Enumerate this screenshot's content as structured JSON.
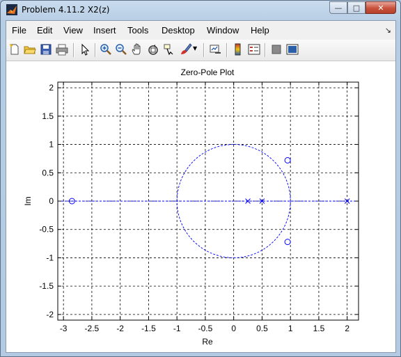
{
  "window": {
    "title": "Problem 4.11.2 X2(z)"
  },
  "menu": [
    "File",
    "Edit",
    "View",
    "Insert",
    "Tools",
    "Desktop",
    "Window",
    "Help"
  ],
  "toolbar": {
    "icons": [
      "new-figure-icon",
      "open-file-icon",
      "save-icon",
      "print-icon",
      "select-arrow-icon",
      "zoom-in-icon",
      "zoom-out-icon",
      "pan-hand-icon",
      "rotate-3d-icon",
      "data-cursor-icon",
      "brush-icon",
      "brush-dropdown-icon",
      "link-plot-icon",
      "colorbar-icon",
      "legend-icon",
      "hide-plot-tools-icon",
      "show-plot-tools-icon"
    ]
  },
  "chart_data": {
    "type": "scatter",
    "title": "Zero-Pole Plot",
    "xlabel": "Re",
    "ylabel": "Im",
    "xlim": [
      -3.1,
      2.2
    ],
    "ylim": [
      -2.1,
      2.1
    ],
    "xticks": [
      "-3",
      "-2.5",
      "-2",
      "-1.5",
      "-1",
      "-0.5",
      "0",
      "0.5",
      "1",
      "1.5",
      "2"
    ],
    "yticks": [
      "2",
      "1.5",
      "1",
      "0.5",
      "0",
      "-0.5",
      "-1",
      "-1.5",
      "-2"
    ],
    "grid": true,
    "unit_circle": true,
    "zeros": [
      {
        "x": -2.85,
        "y": 0
      },
      {
        "x": 0.95,
        "y": 0.72
      },
      {
        "x": 0.95,
        "y": -0.72
      }
    ],
    "poles": [
      {
        "x": 0.25,
        "y": 0
      },
      {
        "x": 0.5,
        "y": 0
      },
      {
        "x": 2,
        "y": 0
      }
    ],
    "color": "#0000ff"
  }
}
